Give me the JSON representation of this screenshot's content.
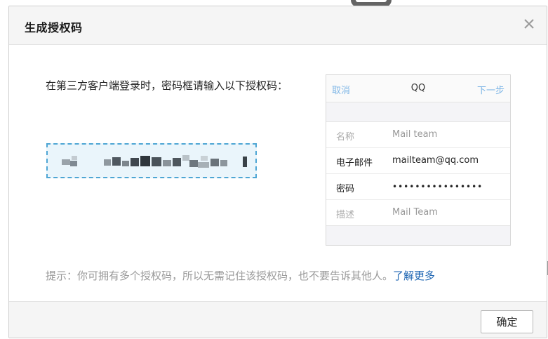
{
  "dialog": {
    "title": "生成授权码",
    "instruction": "在第三方客户端登录时，密码框请输入以下授权码：",
    "auth_code": "",
    "tip_prefix": "提示：你可拥有多个授权码，所以无需记住该授权码，也不要告诉其他人。",
    "tip_link": "了解更多",
    "ok_button": "确定"
  },
  "phone_preview": {
    "cancel": "取消",
    "title": "QQ",
    "next": "下一步",
    "rows": [
      {
        "label": "名称",
        "value": "Mail team"
      },
      {
        "label": "电子邮件",
        "value": "mailteam@qq.com"
      },
      {
        "label": "密码",
        "value": "••••••••••••••••"
      },
      {
        "label": "描述",
        "value": "Mail Team"
      }
    ]
  },
  "colors": {
    "link": "#1f66b3",
    "code_border": "#4ea6d4",
    "code_background": "#eaf5fb",
    "phone_accent": "#7fb6e6"
  },
  "icons": {
    "close": "close-icon"
  }
}
